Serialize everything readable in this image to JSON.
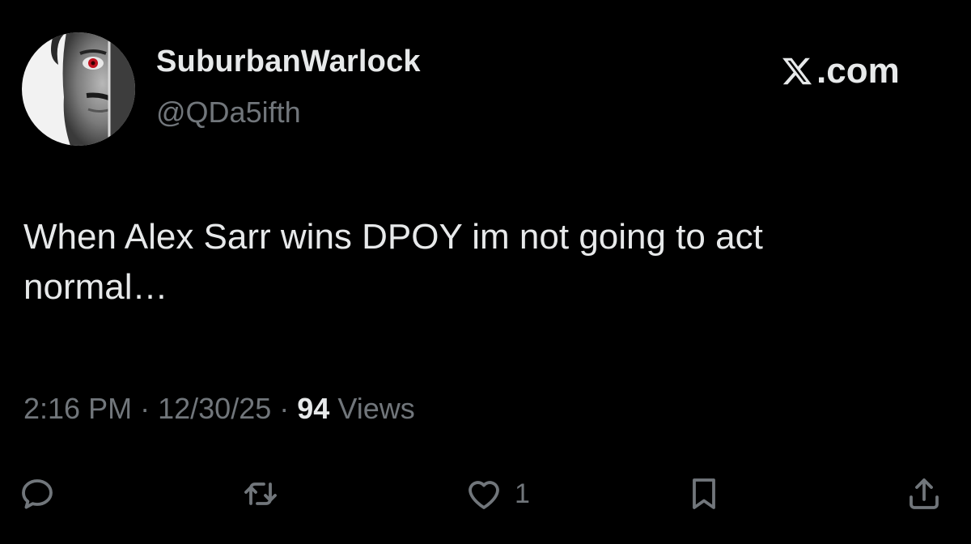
{
  "user": {
    "display_name": "SuburbanWarlock",
    "handle": "@QDa5ifth",
    "avatar_icon": "avatar-image"
  },
  "brand": {
    "text": ".com",
    "icon": "x-logo-icon"
  },
  "tweet": {
    "text": "When Alex Sarr wins DPOY im not going to act\nnormal…"
  },
  "meta": {
    "time": "2:16 PM",
    "separator": "·",
    "date": "12/30/25",
    "views_count": "94",
    "views_label": "Views"
  },
  "actions": {
    "reply": {
      "icon": "reply-icon"
    },
    "repost": {
      "icon": "repost-icon"
    },
    "like": {
      "icon": "heart-icon",
      "count": "1"
    },
    "bookmark": {
      "icon": "bookmark-icon"
    },
    "share": {
      "icon": "share-icon"
    }
  },
  "colors": {
    "background": "#000000",
    "primary_text": "#e7e9ea",
    "secondary_text": "#71767b",
    "avatar_eye": "#c1121f"
  }
}
